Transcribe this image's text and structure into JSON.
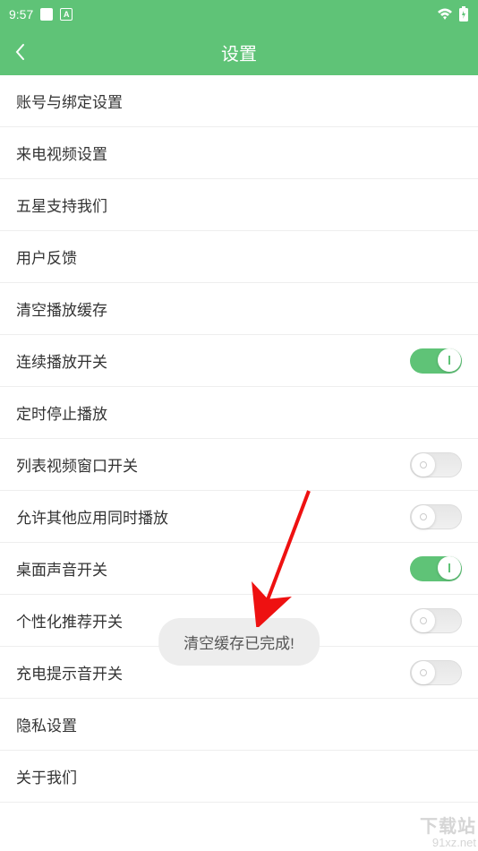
{
  "status": {
    "time": "9:57",
    "indicator": "A"
  },
  "header": {
    "title": "设置"
  },
  "rows": {
    "account": "账号与绑定设置",
    "incoming_video": "来电视频设置",
    "rate_us": "五星支持我们",
    "feedback": "用户反馈",
    "clear_cache": "清空播放缓存",
    "continuous_play": "连续播放开关",
    "timer_stop": "定时停止播放",
    "list_video_window": "列表视频窗口开关",
    "allow_other_apps": "允许其他应用同时播放",
    "desktop_sound": "桌面声音开关",
    "personalized_rec": "个性化推荐开关",
    "charging_sound": "充电提示音开关",
    "privacy": "隐私设置",
    "about": "关于我们"
  },
  "toast": {
    "message": "清空缓存已完成!"
  },
  "watermark": {
    "top": "下载站",
    "bottom": "91xz.net"
  }
}
